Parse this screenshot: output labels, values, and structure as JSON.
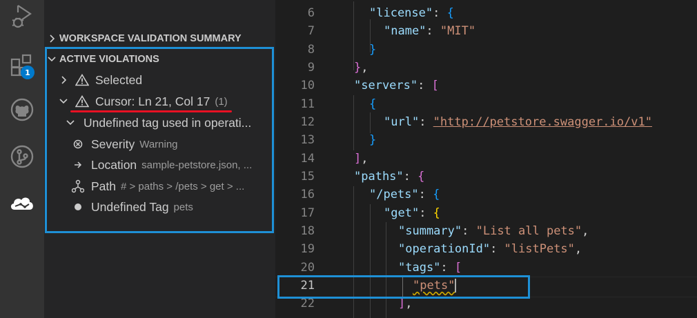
{
  "activity_bar": {
    "items": [
      {
        "name": "run-debug-icon"
      },
      {
        "name": "extensions-icon",
        "badge": "1"
      },
      {
        "name": "github-icon"
      },
      {
        "name": "source-control-icon"
      },
      {
        "name": "cloud-icon"
      }
    ]
  },
  "sidebar": {
    "sections": [
      {
        "label": "WORKSPACE VALIDATION SUMMARY",
        "expanded": false
      },
      {
        "label": "ACTIVE VIOLATIONS",
        "expanded": true
      }
    ],
    "tree": {
      "selected": {
        "label": "Selected"
      },
      "cursor": {
        "label": "Cursor: Ln 21, Col 17",
        "count": "(1)"
      },
      "violation": {
        "label": "Undefined tag used in operati..."
      },
      "severity": {
        "label": "Severity",
        "value": "Warning"
      },
      "location": {
        "label": "Location",
        "value": "sample-petstore.json, ..."
      },
      "path": {
        "label": "Path",
        "value": "# > paths > /pets > get > ..."
      },
      "tag": {
        "label": "Undefined Tag",
        "value": "pets"
      }
    }
  },
  "editor": {
    "active_line": 21,
    "lines": [
      {
        "n": "6"
      },
      {
        "n": "7"
      },
      {
        "n": "8"
      },
      {
        "n": "9"
      },
      {
        "n": "10"
      },
      {
        "n": "11"
      },
      {
        "n": "12"
      },
      {
        "n": "13"
      },
      {
        "n": "14"
      },
      {
        "n": "15"
      },
      {
        "n": "16"
      },
      {
        "n": "17"
      },
      {
        "n": "18"
      },
      {
        "n": "19"
      },
      {
        "n": "20"
      },
      {
        "n": "21"
      },
      {
        "n": "22"
      }
    ],
    "tokens": {
      "license_key": "\"license\"",
      "name_key": "\"name\"",
      "mit": "\"MIT\"",
      "servers_key": "\"servers\"",
      "url_key": "\"url\"",
      "url_val": "\"http://petstore.swagger.io/v1\"",
      "paths_key": "\"paths\"",
      "pets_path": "\"/pets\"",
      "get_key": "\"get\"",
      "summary_key": "\"summary\"",
      "summary_val": "\"List all pets\"",
      "opid_key": "\"operationId\"",
      "opid_val": "\"listPets\"",
      "tags_key": "\"tags\"",
      "pets_tag": "\"pets\""
    }
  },
  "colors": {
    "accent": "#1e90d6",
    "error_underline": "#e81123",
    "warning_squiggle": "#cca700"
  }
}
